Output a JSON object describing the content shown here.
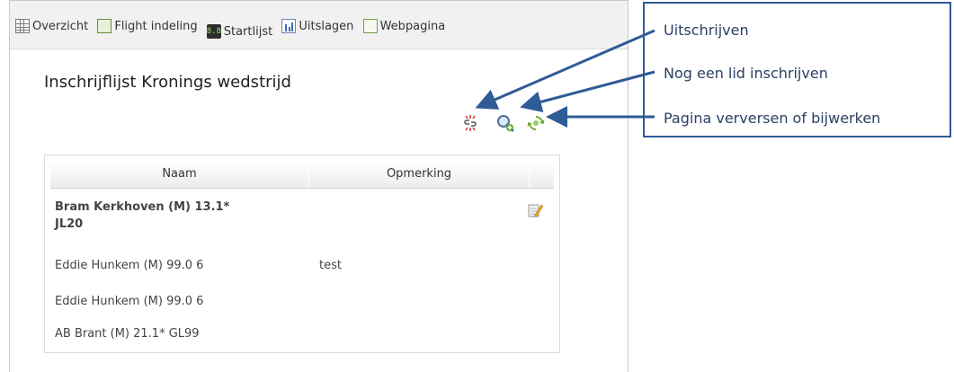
{
  "toolbar": {
    "items": [
      {
        "label": "Overzicht",
        "icon": "grid-icon"
      },
      {
        "label": "Flight indeling",
        "icon": "flight-layout-icon"
      },
      {
        "label": "Startlijst",
        "icon": "start-list-icon",
        "icon_text": "8.8"
      },
      {
        "label": "Uitslagen",
        "icon": "results-chart-icon"
      },
      {
        "label": "Webpagina",
        "icon": "webpage-icon"
      }
    ]
  },
  "page": {
    "title": "Inschrijflijst Kronings wedstrijd"
  },
  "actions": [
    {
      "name": "unsubscribe-icon"
    },
    {
      "name": "add-member-icon"
    },
    {
      "name": "refresh-icon"
    }
  ],
  "table": {
    "headers": [
      "Naam",
      "Opmerking",
      ""
    ],
    "rows": [
      {
        "naam_line1": "Bram Kerkhoven (M) 13.1*",
        "naam_line2": "JL20",
        "opmerking": "",
        "bold": true
      },
      {
        "naam_line1": "Eddie Hunkem (M) 99.0 6",
        "naam_line2": "",
        "opmerking": "test",
        "bold": false
      },
      {
        "naam_line1": "Eddie Hunkem (M) 99.0 6",
        "naam_line2": "",
        "opmerking": "",
        "bold": false
      },
      {
        "naam_line1": "AB Brant (M) 21.1* GL99",
        "naam_line2": "",
        "opmerking": "",
        "bold": false
      }
    ]
  },
  "annotations": {
    "items": [
      "Uitschrijven",
      "Nog een lid inschrijven",
      "Pagina verversen of bijwerken"
    ],
    "color": "#2f5b96"
  }
}
